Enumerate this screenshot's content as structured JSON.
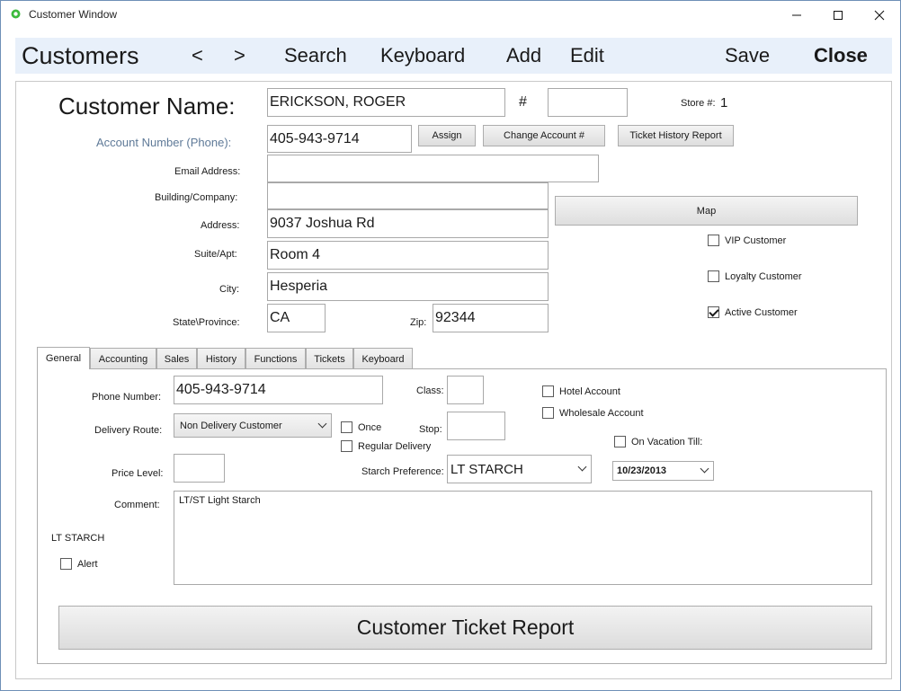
{
  "window": {
    "title": "Customer Window"
  },
  "toolbar": {
    "title": "Customers",
    "prev": "<",
    "next": ">",
    "search": "Search",
    "keyboard": "Keyboard",
    "add": "Add",
    "edit": "Edit",
    "save": "Save",
    "close": "Close"
  },
  "customer": {
    "name_label": "Customer Name:",
    "name": "ERICKSON, ROGER",
    "number_label": "#",
    "number": "",
    "store_label": "Store #:",
    "store": "1",
    "account_label": "Account Number (Phone):",
    "account": "405-943-9714",
    "assign": "Assign",
    "change_account": "Change Account #",
    "ticket_history": "Ticket History Report",
    "email_label": "Email Address:",
    "email": "",
    "company_label": "Building/Company:",
    "company": "",
    "address_label": "Address:",
    "address": "9037 Joshua Rd",
    "suite_label": "Suite/Apt:",
    "suite": "Room 4",
    "city_label": "City:",
    "city": "Hesperia",
    "state_label": "State\\Province:",
    "state": "CA",
    "zip_label": "Zip:",
    "zip": "92344",
    "map": "Map",
    "vip_label": "VIP Customer",
    "vip": false,
    "loyalty_label": "Loyalty Customer",
    "loyalty": false,
    "active_label": "Active Customer",
    "active": true
  },
  "tabs": [
    "General",
    "Accounting",
    "Sales",
    "History",
    "Functions",
    "Tickets",
    "Keyboard"
  ],
  "active_tab": "General",
  "general": {
    "phone_label": "Phone Number:",
    "phone": "405-943-9714",
    "class_label": "Class:",
    "class": "",
    "hotel_label": "Hotel Account",
    "wholesale_label": "Wholesale Account",
    "route_label": "Delivery Route:",
    "route": "Non Delivery Customer",
    "once_label": "Once",
    "regular_label": "Regular Delivery",
    "stop_label": "Stop:",
    "stop": "",
    "vacation_label": "On Vacation Till:",
    "vacation_date": "10/23/2013",
    "price_label": "Price Level:",
    "price": "",
    "starch_label": "Starch Preference:",
    "starch": "LT STARCH",
    "comment_label": "Comment:",
    "comment": "LT/ST Light Starch",
    "alert_text": "LT STARCH",
    "alert_label": "Alert",
    "report_button": "Customer Ticket Report"
  }
}
